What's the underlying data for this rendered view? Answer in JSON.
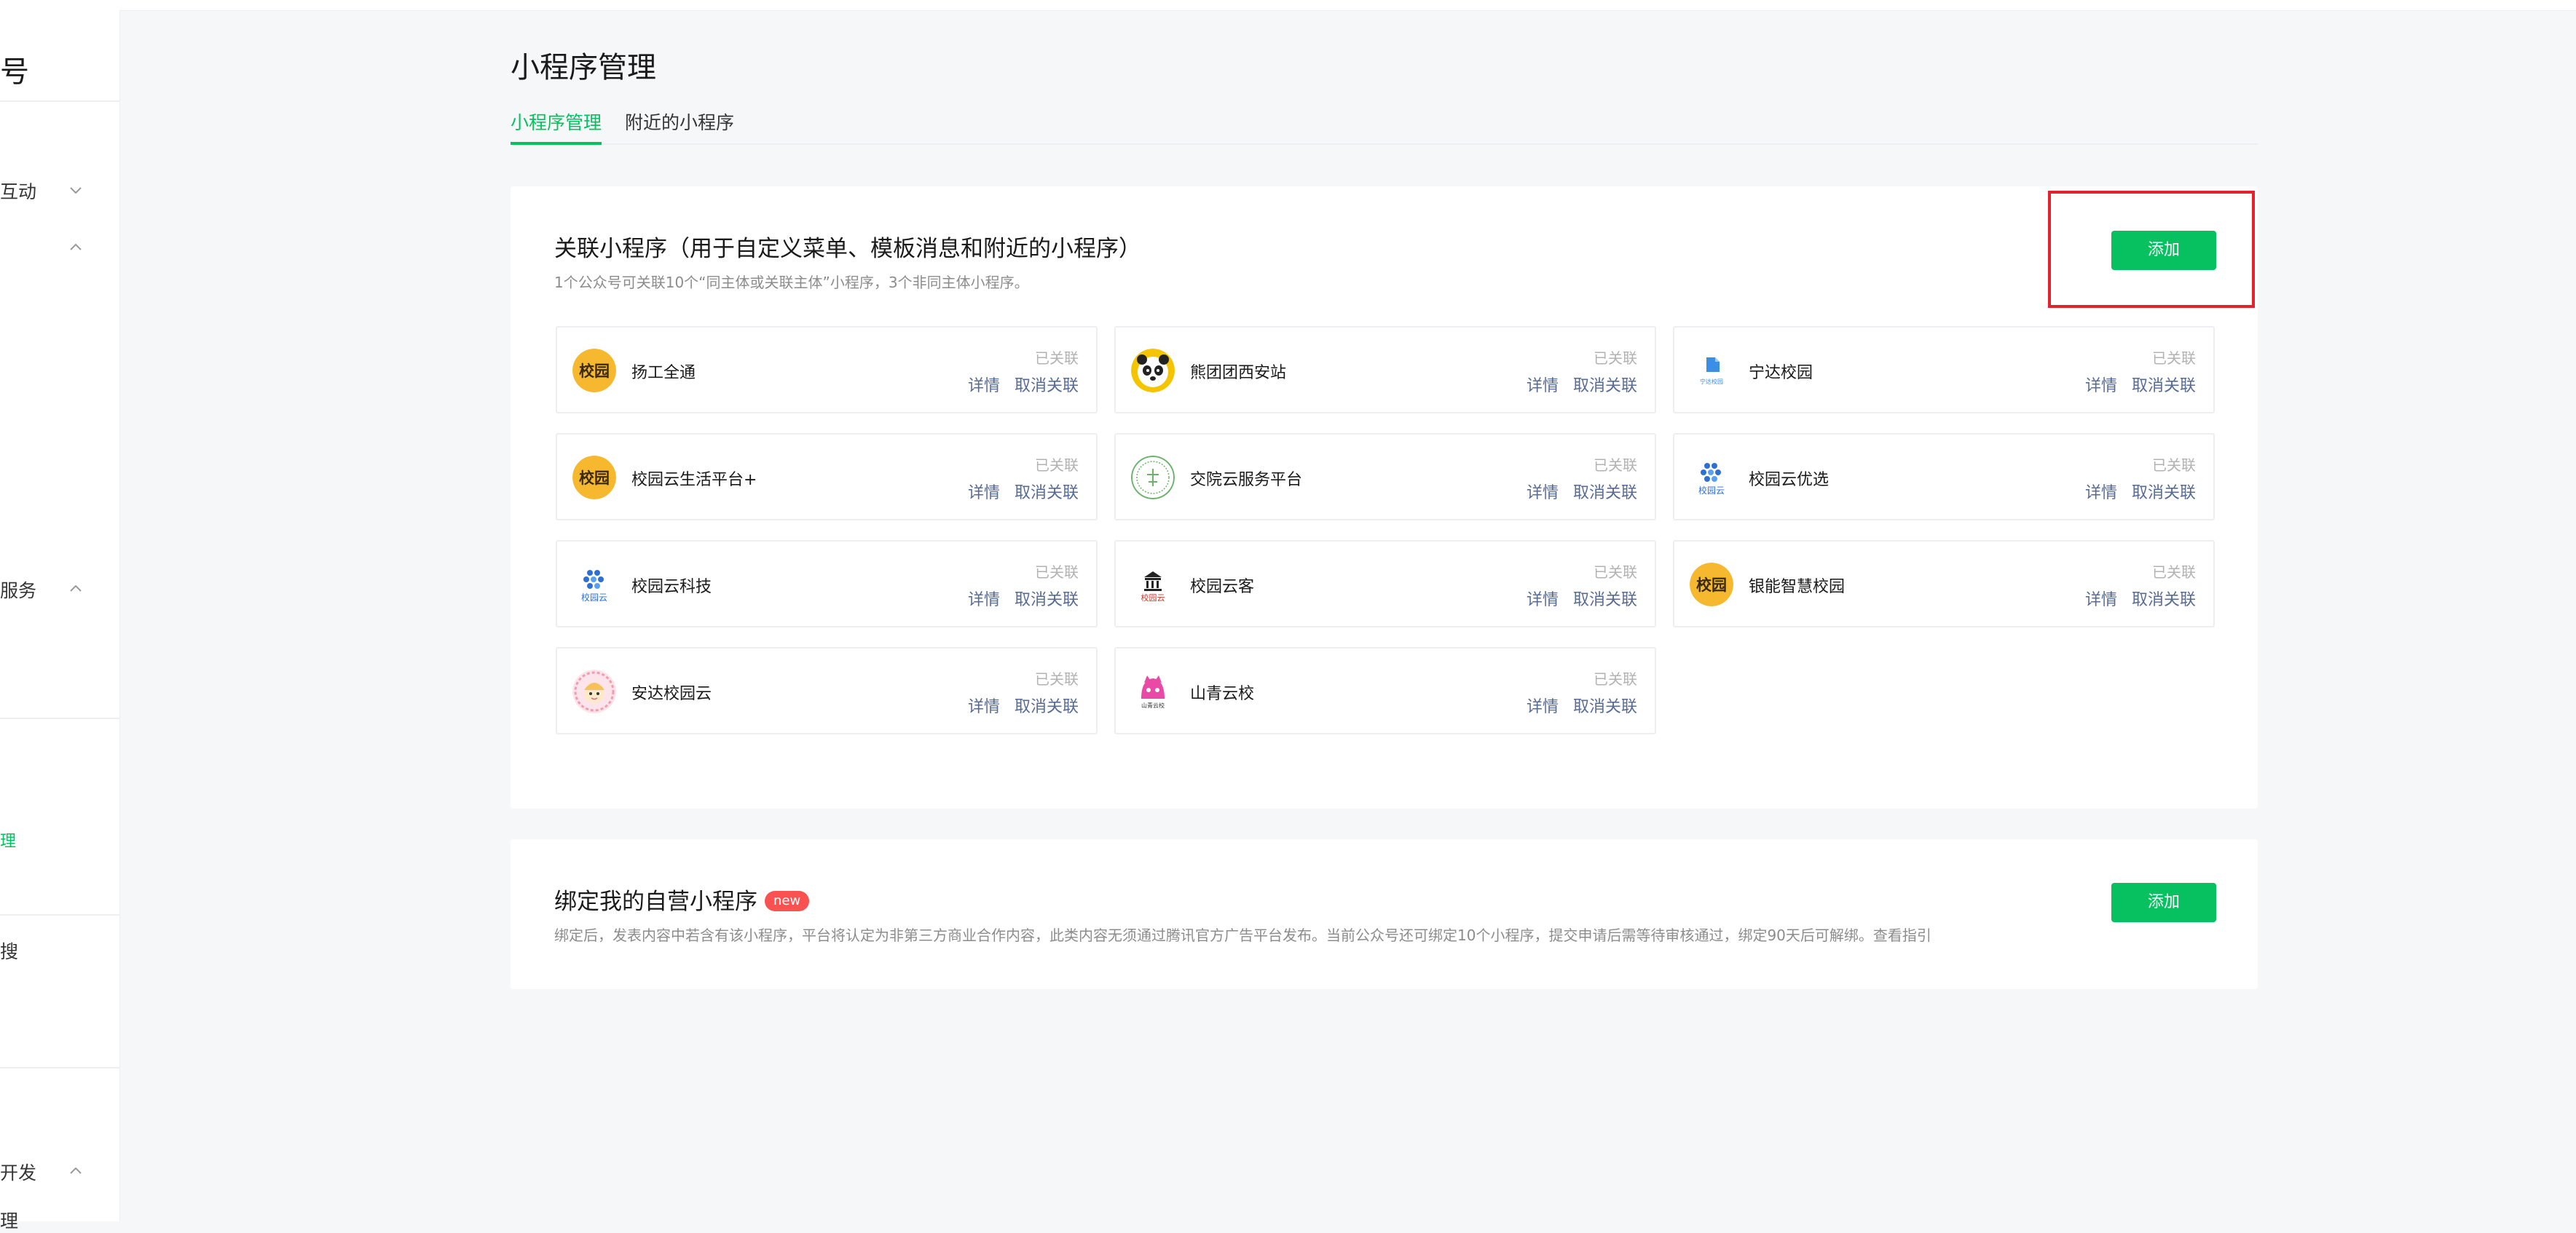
{
  "colors": {
    "accent": "#07c160",
    "link": "#576b95",
    "highlight": "#e5222b",
    "badge": "#fa5151"
  },
  "sidebar": {
    "title": "号",
    "items": [
      {
        "label": "互动",
        "expanded": false
      },
      {
        "label": "",
        "expanded": true
      },
      {
        "label": "服务",
        "expanded": true
      },
      {
        "label": "理",
        "active": true
      },
      {
        "label": "搜"
      },
      {
        "label": "开发",
        "expanded": true
      },
      {
        "label": "理"
      }
    ]
  },
  "page": {
    "title": "小程序管理"
  },
  "tabs": [
    {
      "label": "小程序管理",
      "active": true
    },
    {
      "label": "附近的小程序",
      "active": false
    }
  ],
  "linked": {
    "title": "关联小程序（用于自定义菜单、模板消息和附近的小程序）",
    "subtitle": "1个公众号可关联10个“同主体或关联主体”小程序，3个非同主体小程序。",
    "add_label": "添加",
    "items": [
      {
        "name": "扬工全通",
        "status": "已关联",
        "detail": "详情",
        "unlink": "取消关联",
        "icon": "xiaoyuan-logo-icon"
      },
      {
        "name": "熊团团西安站",
        "status": "已关联",
        "detail": "详情",
        "unlink": "取消关联",
        "icon": "panda-logo-icon"
      },
      {
        "name": "宁达校园",
        "status": "已关联",
        "detail": "详情",
        "unlink": "取消关联",
        "icon": "ningda-logo-icon"
      },
      {
        "name": "校园云生活平台+",
        "status": "已关联",
        "detail": "详情",
        "unlink": "取消关联",
        "icon": "xiaoyuan-logo-icon"
      },
      {
        "name": "交院云服务平台",
        "status": "已关联",
        "detail": "详情",
        "unlink": "取消关联",
        "icon": "jiaoyuan-seal-icon"
      },
      {
        "name": "校园云优选",
        "status": "已关联",
        "detail": "详情",
        "unlink": "取消关联",
        "icon": "xiaoyuanyun-logo-icon"
      },
      {
        "name": "校园云科技",
        "status": "已关联",
        "detail": "详情",
        "unlink": "取消关联",
        "icon": "xiaoyuanyun-logo-icon"
      },
      {
        "name": "校园云客",
        "status": "已关联",
        "detail": "详情",
        "unlink": "取消关联",
        "icon": "building-logo-icon"
      },
      {
        "name": "银能智慧校园",
        "status": "已关联",
        "detail": "详情",
        "unlink": "取消关联",
        "icon": "xiaoyuan-logo-icon"
      },
      {
        "name": "安达校园云",
        "status": "已关联",
        "detail": "详情",
        "unlink": "取消关联",
        "icon": "cartoon-logo-icon"
      },
      {
        "name": "山青云校",
        "status": "已关联",
        "detail": "详情",
        "unlink": "取消关联",
        "icon": "cat-logo-icon"
      }
    ]
  },
  "bound": {
    "title": "绑定我的自营小程序",
    "badge": "new",
    "subtitle": "绑定后，发表内容中若含有该小程序，平台将认定为非第三方商业合作内容，此类内容无须通过腾讯官方广告平台发布。当前公众号还可绑定10个小程序，提交申请后需等待审核通过，绑定90天后可解绑。查看指引",
    "add_label": "添加"
  },
  "logo_text": {
    "xiaoyuan": "校园",
    "ningda": "宁达校园",
    "xiaoyuanyun": "校园云",
    "shanqing": "山青云校"
  }
}
